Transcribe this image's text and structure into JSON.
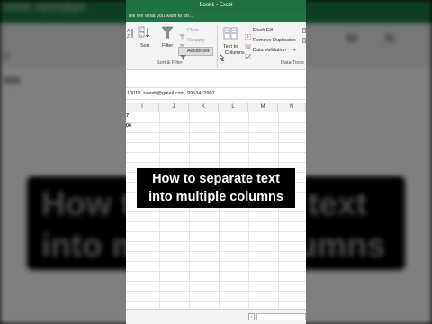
{
  "app": {
    "window_title": "Book1 - Excel",
    "tell_me": "Tell me what you want to do..."
  },
  "ribbon": {
    "sort_label": "Sort",
    "filter_label": "Filter",
    "clear_label": "Clear",
    "reapply_label": "Reapply",
    "advanced_label": "Advanced",
    "sort_filter_group": "Sort & Filter",
    "text_to_columns_line1": "Text to",
    "text_to_columns_line2": "Columns",
    "flash_fill_label": "Flash Fill",
    "remove_duplicates_label": "Remove Duplicates",
    "data_validation_label": "Data Validation",
    "data_tools_group": "Data Tools"
  },
  "formula_bar": {
    "value": "10018, rajesh@gmail.com, 9953412907"
  },
  "sheet": {
    "columns": [
      "I",
      "J",
      "K",
      "L",
      "M",
      "N"
    ],
    "cell_fragment_1": "7",
    "cell_fragment_2": "06"
  },
  "background": {
    "blurred_text": "10016, rajesh@gm",
    "blurred_row_1": "7",
    "blurred_row_2": "006",
    "blurred_col_m": "M",
    "blurred_col_n": "N"
  },
  "caption": {
    "line1": "How to separate text",
    "line2": "into multiple columns",
    "bg_line1": "How to separate text",
    "bg_line2": "into multiple columns"
  },
  "colors": {
    "excel_green": "#217346",
    "caption_bg": "#000000",
    "caption_fg": "#ffffff"
  }
}
